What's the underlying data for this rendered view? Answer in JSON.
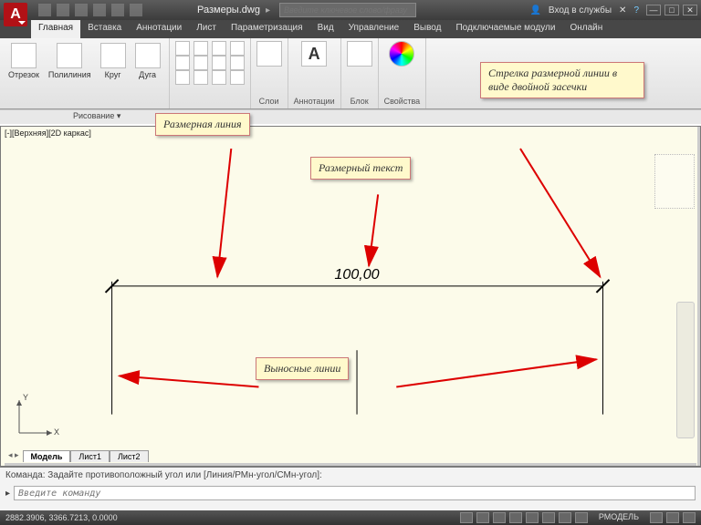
{
  "app": {
    "logo": "A",
    "doc": "Размеры.dwg",
    "search_ph": "Введите ключевое слово/фразу",
    "signin": "Вход в службы"
  },
  "tabs": [
    "Главная",
    "Вставка",
    "Аннотации",
    "Лист",
    "Параметризация",
    "Вид",
    "Управление",
    "Вывод",
    "Подключаемые модули",
    "Онлайн"
  ],
  "ribbon": {
    "draw": {
      "seg": "Отрезок",
      "pline": "Полилиния",
      "circ": "Круг",
      "arc": "Дуга",
      "title": "Рисование"
    },
    "layer": "Слои",
    "anno": "Аннотации",
    "block": "Блок",
    "prop": "Свойства"
  },
  "viewport": "[‑][Верхняя][2D каркас]",
  "callouts": {
    "dimline": "Размерная линия",
    "dimtext": "Размерный текст",
    "extlines": "Выносные линии",
    "arrowtick": "Стрелка размерной линии в виде двойной засечки"
  },
  "dim_value": "100,00",
  "model_tabs": [
    "Модель",
    "Лист1",
    "Лист2"
  ],
  "axes": {
    "x": "X",
    "y": "Y"
  },
  "cmd": {
    "hist": "Команда: Задайте противоположный угол или [Линия/РМн-угол/СМн-угол]:",
    "ph": "Введите команду",
    "prompt": "▸"
  },
  "status": {
    "coords": "2882.3906, 3366.7213, 0.0000",
    "space": "РМОДЕЛЬ"
  }
}
